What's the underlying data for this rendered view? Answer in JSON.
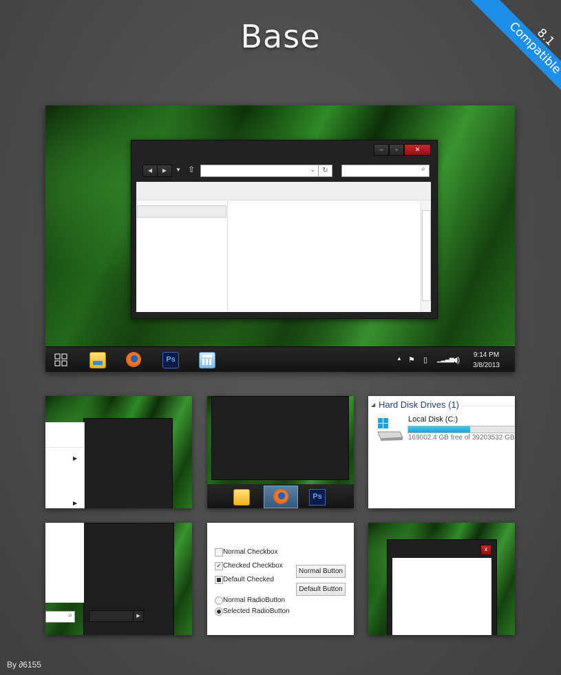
{
  "header": {
    "title": "Base"
  },
  "ribbon": {
    "line1": "8.1",
    "line2": "Compatible",
    "color": "#1f8ee6"
  },
  "taskbar": {
    "apps": [
      {
        "name": "file-explorer",
        "icon": "folder-icon"
      },
      {
        "name": "firefox",
        "icon": "firefox-icon"
      },
      {
        "name": "photoshop",
        "icon": "photoshop-icon",
        "label": "Ps"
      },
      {
        "name": "calculator",
        "icon": "calculator-icon"
      }
    ],
    "time": "9:14 PM",
    "date": "3/8/2013"
  },
  "explorer": {
    "close_color": "#b71c1c"
  },
  "disk": {
    "group_title": "Hard Disk Drives (1)",
    "drive_name": "Local Disk (C:)",
    "free_text": "169002.4 GB free of 39203532 GB",
    "used_fraction": 0.58
  },
  "controls": {
    "normal_checkbox": "Normal Checkbox",
    "checked_checkbox": "Checked Checkbox",
    "default_checked": "Default Checked",
    "normal_radio": "Normal RadioButton",
    "selected_radio": "Selected RadioButton",
    "normal_button": "Normal Button",
    "default_button": "Default Button"
  },
  "thumb_taskbar": {
    "ps_label": "Ps"
  },
  "small_close": {
    "label": "x"
  },
  "byline": {
    "text": "By ",
    "author": "6155"
  }
}
